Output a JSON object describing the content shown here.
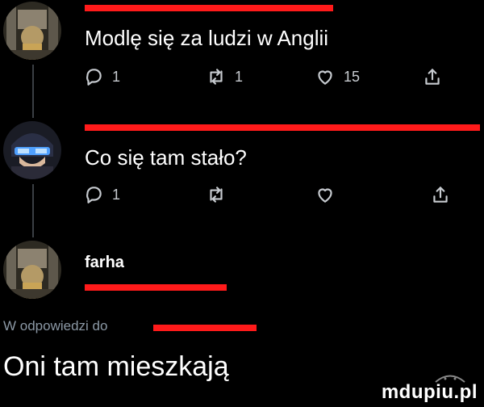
{
  "tweets": [
    {
      "text": "Modlę się za ludzi w Anglii",
      "replies": "1",
      "retweets": "1",
      "likes": "15",
      "avatar_icon": "artwork-avatar-icon"
    },
    {
      "text": "Co się tam stało?",
      "replies": "1",
      "retweets": "",
      "likes": "",
      "avatar_icon": "anime-character-avatar-icon"
    }
  ],
  "reply_tweet": {
    "author": "farha",
    "reply_prefix": "W odpowiedzi do",
    "text": "Oni tam mieszkają",
    "avatar_icon": "artwork-avatar-icon"
  },
  "icons": {
    "reply": "reply-icon",
    "retweet": "retweet-icon",
    "like": "heart-icon",
    "share": "share-icon"
  },
  "colors": {
    "background": "#000000",
    "redaction": "#ff1a1a",
    "secondary_text": "#8b98a5"
  },
  "watermark": "mdupiu.pl"
}
